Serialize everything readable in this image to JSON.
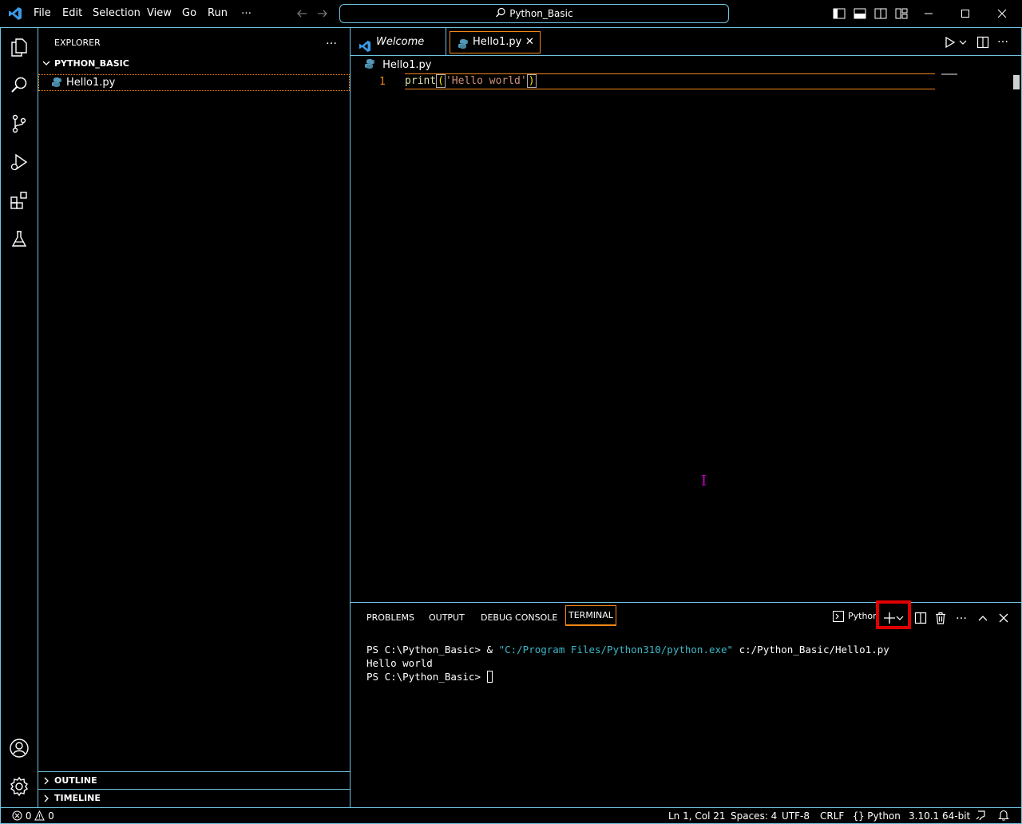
{
  "menu": {
    "items": [
      "File",
      "Edit",
      "Selection",
      "View",
      "Go",
      "Run",
      "…"
    ]
  },
  "title": {
    "search_text": "Python_Basic"
  },
  "explorer": {
    "title": "EXPLORER",
    "more": "…",
    "folder": "PYTHON_BASIC",
    "files": [
      "Hello1.py"
    ],
    "outline": "OUTLINE",
    "timeline": "TIMELINE"
  },
  "tabs": {
    "welcome": "Welcome",
    "hello": "Hello1.py",
    "close": "✕"
  },
  "breadcrumb": "Hello1.py",
  "editor": {
    "line_number": "1",
    "code_fn": "print",
    "code_open": "(",
    "code_str": "'Hello world'",
    "code_close": ")"
  },
  "panel": {
    "tabs": [
      "PROBLEMS",
      "OUTPUT",
      "DEBUG CONSOLE",
      "TERMINAL"
    ],
    "active_tab": "TERMINAL",
    "terminal_profile": "Python"
  },
  "terminal": {
    "line1_prompt": "PS C:\\Python_Basic> & ",
    "line1_str": "\"C:/Program Files/Python310/python.exe\"",
    "line1_rest": " c:/Python_Basic/Hello1.py",
    "line2": "Hello world",
    "line3": "PS C:\\Python_Basic> "
  },
  "status": {
    "errors": "0",
    "warnings": "0",
    "position": "Ln 1, Col 21",
    "spaces": "Spaces: 4",
    "encoding": "UTF-8",
    "eol": "CRLF",
    "language": "Python",
    "interpreter": "3.10.1 64-bit"
  },
  "colors": {
    "border": "#6fc3df",
    "focus": "#f38518",
    "highlight": "#e00000",
    "string": "#ce9178"
  }
}
